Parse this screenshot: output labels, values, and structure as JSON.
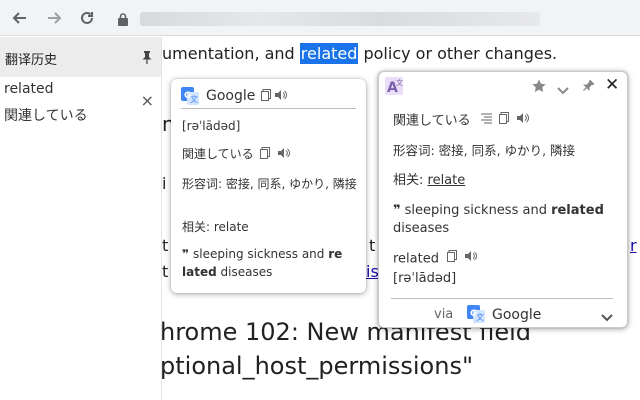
{
  "browser": {
    "icons": [
      "back-arrow-icon",
      "forward-arrow-icon",
      "reload-icon",
      "lock-icon"
    ]
  },
  "sidebar": {
    "title": "翻译历史",
    "history": [
      {
        "word": "related",
        "translation": "関連している"
      }
    ],
    "close_symbol": "×"
  },
  "page": {
    "line1_before": "umentation, and ",
    "line1_highlight": "related",
    "line1_after": " policy or other changes.",
    "frag_n": "n",
    "frag_i": "i",
    "frag_t": "t",
    "frag_is": "is",
    "frag_r": "r",
    "heading_line1": "hrome 102: New manifest field",
    "heading_line2": "ptional_host_permissions\""
  },
  "google_popup": {
    "engine": "Google",
    "phonetic": "[rəˈlādəd]",
    "translation": "関連している",
    "adjective": "形容词: 密接, 同系, ゆかり, 隣接",
    "related": "相关: relate",
    "example_pre": "sleeping sickness and ",
    "example_bold_1": "re",
    "example_bold_2": "lated",
    "example_post": " diseases",
    "quote_symbol": "❞"
  },
  "main_popup": {
    "translation": "関連している",
    "adjective": "形容词: 密接, 同系, ゆかり, 隣接",
    "related_label": "相关: ",
    "related_word": "relate",
    "example_pre": "sleeping sickness and ",
    "example_bold": "related",
    "example_post": "diseases",
    "word": "related",
    "phonetic": "[rəˈlādəd]",
    "via_label": "via",
    "engine": "Google",
    "quote_symbol": "❞",
    "close_symbol": "✕"
  },
  "colors": {
    "highlight": "#1a73e8",
    "google_blue": "#4285f4",
    "logo_purple": "#7b5ea7"
  }
}
